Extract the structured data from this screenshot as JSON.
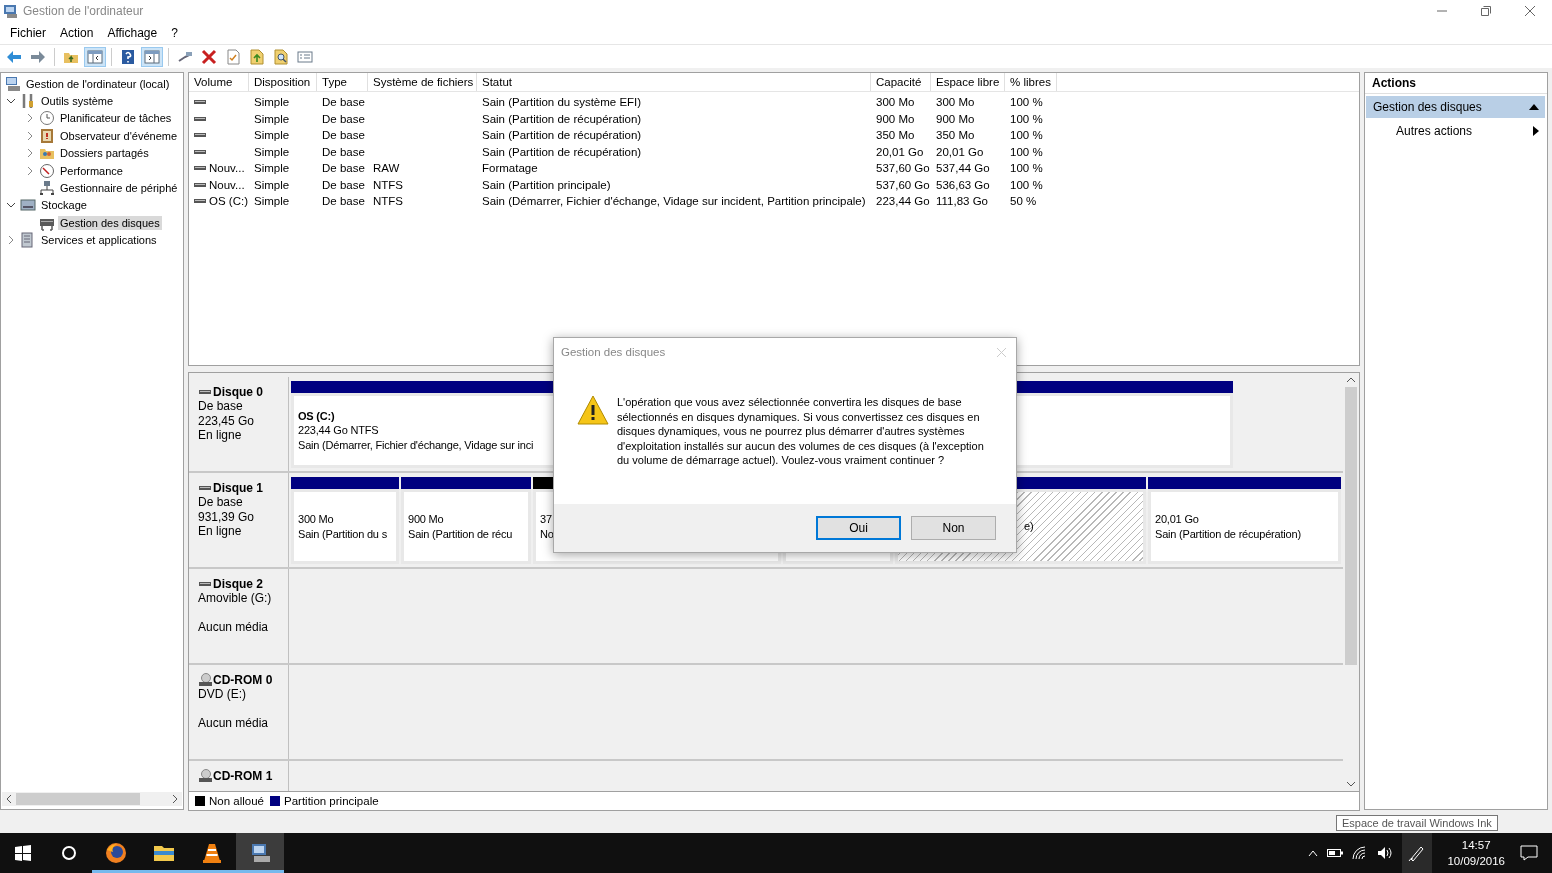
{
  "window": {
    "title": "Gestion de l'ordinateur"
  },
  "menu": [
    "Fichier",
    "Action",
    "Affichage",
    "?"
  ],
  "toolbar": [
    {
      "kind": "back",
      "on": false
    },
    {
      "kind": "forward",
      "on": false
    },
    {
      "kind": "folder-up",
      "on": false
    },
    {
      "kind": "console-tree",
      "on": true
    },
    {
      "kind": "help",
      "on": false
    },
    {
      "kind": "action-pane",
      "on": true
    },
    {
      "kind": "connect",
      "on": false
    },
    {
      "kind": "delete",
      "on": false
    },
    {
      "kind": "properties",
      "on": false
    },
    {
      "kind": "export",
      "on": false
    },
    {
      "kind": "find",
      "on": false
    },
    {
      "kind": "list",
      "on": false
    }
  ],
  "tree": [
    {
      "label": "Gestion de l'ordinateur (local)",
      "kind": "computer",
      "selected": false,
      "children": [
        {
          "label": "Outils système",
          "kind": "tools",
          "expanded": true,
          "selected": false,
          "children": [
            {
              "label": "Planificateur de tâches",
              "kind": "clock",
              "expanded": false,
              "selected": false
            },
            {
              "label": "Observateur d'événeme",
              "kind": "event",
              "expanded": false,
              "selected": false
            },
            {
              "label": "Dossiers partagés",
              "kind": "share",
              "expanded": false,
              "selected": false
            },
            {
              "label": "Performance",
              "kind": "perf",
              "expanded": false,
              "selected": false
            },
            {
              "label": "Gestionnaire de périphé",
              "kind": "device",
              "selected": false
            }
          ]
        },
        {
          "label": "Stockage",
          "kind": "storage",
          "expanded": true,
          "selected": false,
          "children": [
            {
              "label": "Gestion des disques",
              "kind": "disk",
              "selected": true
            }
          ]
        },
        {
          "label": "Services et applications",
          "kind": "services",
          "expanded": false,
          "selected": false
        }
      ]
    }
  ],
  "volumes": {
    "columns": [
      "Volume",
      "Disposition",
      "Type",
      "Système de fichiers",
      "Statut",
      "Capacité",
      "Espace libre",
      "% libres"
    ],
    "rows": [
      {
        "layout": "Simple",
        "type": "De base",
        "status": "Sain (Partition du système EFI)",
        "capacity": "300 Mo",
        "free": "300 Mo",
        "pct": "100 %"
      },
      {
        "layout": "Simple",
        "type": "De base",
        "status": "Sain (Partition de récupération)",
        "capacity": "900 Mo",
        "free": "900 Mo",
        "pct": "100 %"
      },
      {
        "layout": "Simple",
        "type": "De base",
        "status": "Sain (Partition de récupération)",
        "capacity": "350 Mo",
        "free": "350 Mo",
        "pct": "100 %"
      },
      {
        "layout": "Simple",
        "type": "De base",
        "status": "Sain (Partition de récupération)",
        "capacity": "20,01 Go",
        "free": "20,01 Go",
        "pct": "100 %"
      },
      {
        "volume": "Nouv...",
        "layout": "Simple",
        "type": "De base",
        "fs": "RAW",
        "status": "Formatage",
        "capacity": "537,60 Go",
        "free": "537,44 Go",
        "pct": "100 %"
      },
      {
        "volume": "Nouv...",
        "layout": "Simple",
        "type": "De base",
        "fs": "NTFS",
        "status": "Sain (Partition principale)",
        "capacity": "537,60 Go",
        "free": "536,63 Go",
        "pct": "100 %"
      },
      {
        "volume": "OS (C:)",
        "layout": "Simple",
        "type": "De base",
        "fs": "NTFS",
        "status": "Sain (Démarrer, Fichier d'échange, Vidage sur incident, Partition principale)",
        "capacity": "223,44 Go",
        "free": "111,83 Go",
        "pct": "50 %"
      }
    ]
  },
  "disks": [
    {
      "name": "Disque 0",
      "kind": "disk",
      "subtitle": "De base",
      "size": "223,45 Go",
      "status": "En ligne",
      "partitions": [
        {
          "kind": "primary",
          "selected": false,
          "label": "OS  (C:)",
          "size": "223,44 Go NTFS",
          "status": "Sain (Démarrer, Fichier d'échange, Vidage sur inci"
        }
      ]
    },
    {
      "name": "Disque 1",
      "kind": "disk",
      "subtitle": "De base",
      "size": "931,39 Go",
      "status": "En ligne",
      "partitions": [
        {
          "kind": "primary",
          "selected": false,
          "size": "300 Mo",
          "status": "Sain (Partition du s"
        },
        {
          "kind": "primary",
          "selected": false,
          "size": "900 Mo",
          "status": "Sain (Partition de récu"
        },
        {
          "kind": "unallocated",
          "selected": false,
          "size": "37",
          "status": "No"
        },
        {
          "selected": false
        },
        {
          "kind": "primary",
          "selected": true,
          "status": "e)"
        },
        {
          "kind": "primary",
          "selected": false,
          "size": "20,01 Go",
          "status": "Sain (Partition de récupération)"
        }
      ]
    },
    {
      "name": "Disque 2",
      "kind": "disk",
      "subtitle": "Amovible (G:)",
      "status": "Aucun média"
    },
    {
      "name": "CD-ROM 0",
      "kind": "cdrom",
      "subtitle": "DVD (E:)",
      "status": "Aucun média"
    },
    {
      "name": "CD-ROM 1",
      "kind": "cdrom"
    }
  ],
  "legend": [
    {
      "label": "Non alloué",
      "color": "#000000"
    },
    {
      "label": "Partition principale",
      "color": "#000080"
    }
  ],
  "actions": {
    "title": "Actions",
    "items": [
      {
        "label": "Gestion des disques",
        "kind": "header",
        "expanded": true
      },
      {
        "label": "Autres actions",
        "kind": "submenu"
      }
    ]
  },
  "dialog": {
    "title": "Gestion des disques",
    "message": "L'opération que vous avez sélectionnée convertira les disques de base sélectionnés en disques dynamiques. Si vous convertissez ces disques en disques dynamiques, vous ne pourrez plus démarrer d'autres systèmes d'exploitation installés sur aucun des volumes de ces disques (à l'exception du volume de démarrage actuel). Voulez-vous vraiment continuer ?",
    "buttons": [
      {
        "label": "Oui",
        "selected": true
      },
      {
        "label": "Non",
        "selected": false
      }
    ]
  },
  "tooltip": "Espace de travail Windows Ink",
  "taskbar": {
    "apps": [
      {
        "kind": "firefox",
        "running": true,
        "active": false
      },
      {
        "kind": "explorer",
        "running": true,
        "active": false
      },
      {
        "kind": "vlc",
        "running": true,
        "active": false
      },
      {
        "kind": "compmgmt",
        "running": true,
        "active": true
      }
    ],
    "time": "14:57",
    "date": "10/09/2016"
  }
}
